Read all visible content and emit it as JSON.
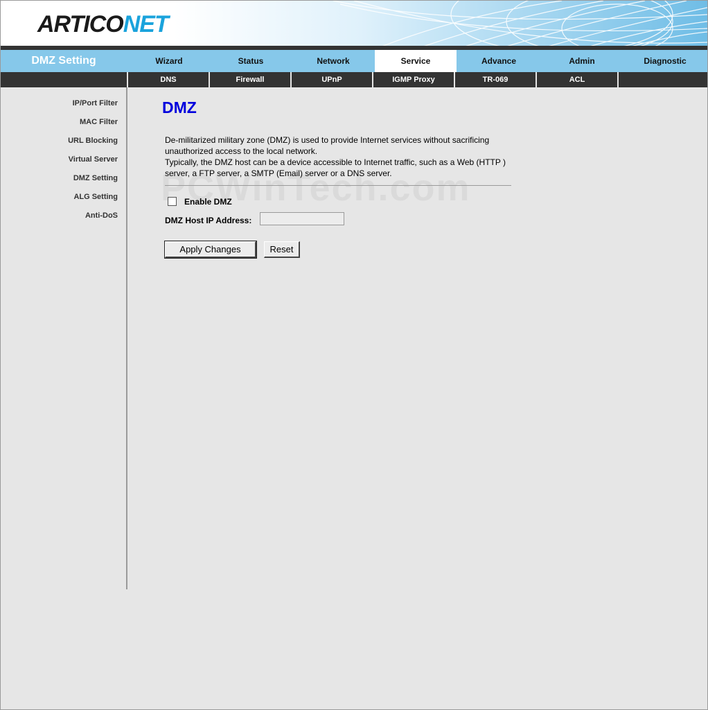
{
  "brand": {
    "logo_part1": "ARTICO",
    "logo_part2": "NET",
    "accent": "#1aa3dc"
  },
  "section_title": "DMZ Setting",
  "main_nav": [
    {
      "label": "Wizard"
    },
    {
      "label": "Status"
    },
    {
      "label": "Network"
    },
    {
      "label": "Service",
      "active": true
    },
    {
      "label": "Advance"
    },
    {
      "label": "Admin"
    },
    {
      "label": "Diagnostic"
    }
  ],
  "sub_nav": [
    {
      "label": "DNS"
    },
    {
      "label": "Firewall"
    },
    {
      "label": "UPnP"
    },
    {
      "label": "IGMP Proxy"
    },
    {
      "label": "TR-069"
    },
    {
      "label": "ACL"
    }
  ],
  "sidebar": [
    {
      "label": "IP/Port Filter"
    },
    {
      "label": "MAC Filter"
    },
    {
      "label": "URL Blocking"
    },
    {
      "label": "Virtual Server"
    },
    {
      "label": "DMZ Setting"
    },
    {
      "label": "ALG Setting"
    },
    {
      "label": "Anti-DoS"
    }
  ],
  "content": {
    "title": "DMZ",
    "description_line1": "De-militarized military zone (DMZ) is used to provide Internet services without sacrificing unauthorized access to the local network.",
    "description_line2": "Typically, the DMZ host can be a device accessible to Internet traffic, such as a Web (HTTP ) server, a FTP server, a SMTP (Email) server or a DNS server.",
    "watermark": "PCWinTech.com",
    "enable_dmz_label": "Enable DMZ",
    "enable_dmz_checked": false,
    "dmz_host_ip_label": "DMZ Host IP Address:",
    "dmz_host_ip_value": "",
    "apply_label": "Apply Changes",
    "reset_label": "Reset"
  },
  "colors": {
    "title_blue": "#0000dd",
    "nav_bg": "#86c8ea",
    "subnav_bg": "#333333",
    "page_bg": "#e6e6e6"
  }
}
